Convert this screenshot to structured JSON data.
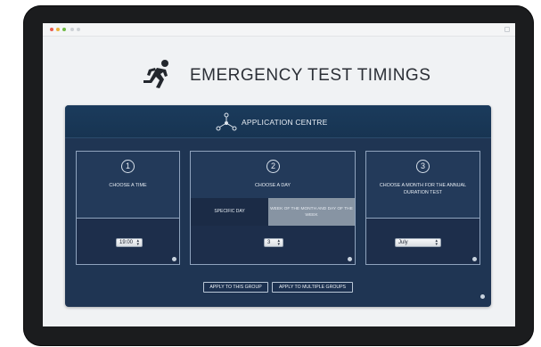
{
  "header": {
    "title": "EMERGENCY TEST TIMINGS",
    "icon": "running-man-icon"
  },
  "panel": {
    "title": "APPLICATION CENTRE",
    "icon": "network-nodes-icon",
    "steps": [
      {
        "number": "1",
        "label": "CHOOSE A TIME",
        "select_value": "19:00"
      },
      {
        "number": "2",
        "label": "CHOOSE A DAY",
        "select_value": "3",
        "tabs": [
          {
            "label": "SPECIFIC DAY"
          },
          {
            "label": "WEEK OF THE MONTH AND DAY OF THE WEEK"
          }
        ]
      },
      {
        "number": "3",
        "label": "CHOOSE A MONTH FOR THE ANNUAL DURATION TEST",
        "select_value": "July"
      }
    ],
    "buttons": {
      "apply_group": "APPLY TO THIS GROUP",
      "apply_multiple": "APPLY TO MULTIPLE GROUPS"
    }
  },
  "colors": {
    "panel": "#1f3553",
    "tab_active": "#1b2b46",
    "tab_inactive": "#8794a3"
  }
}
